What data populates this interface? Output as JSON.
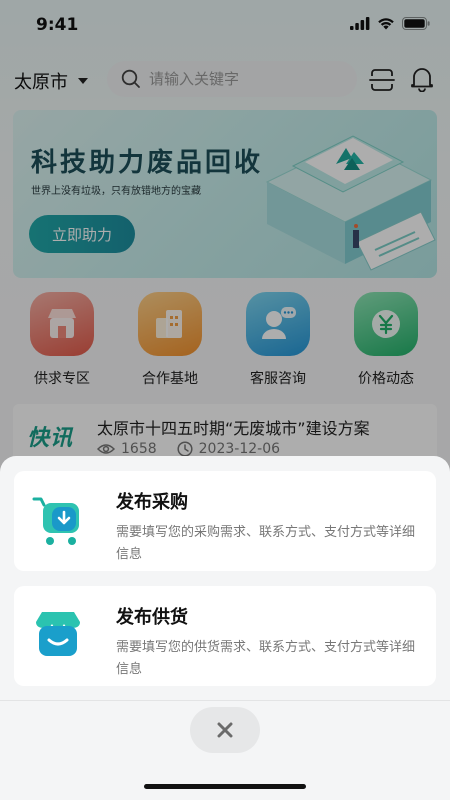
{
  "status_bar": {
    "time": "9:41"
  },
  "header": {
    "city": "太原市",
    "search_placeholder": "请输入关键字"
  },
  "banner": {
    "title": "科技助力废品回收",
    "subtitle": "世界上没有垃圾，只有放错地方的宝藏",
    "button_label": "立即助力"
  },
  "quick_links": [
    {
      "label": "供求专区",
      "icon": "shop-icon"
    },
    {
      "label": "合作基地",
      "icon": "buildings-icon"
    },
    {
      "label": "客服咨询",
      "icon": "customer-service-icon"
    },
    {
      "label": "价格动态",
      "icon": "yuan-coin-icon"
    }
  ],
  "news": {
    "badge": "快讯",
    "headline": "太原市十四五时期“无废城市”建设方案",
    "views": "1658",
    "date": "2023-12-06"
  },
  "sheet": {
    "options": [
      {
        "title": "发布采购",
        "description": "需要填写您的采购需求、联系方式、支付方式等详细信息",
        "icon": "shopping-cart-icon"
      },
      {
        "title": "发布供货",
        "description": "需要填写您的供货需求、联系方式、支付方式等详细信息",
        "icon": "store-icon"
      }
    ],
    "close_icon": "close-icon"
  },
  "colors": {
    "accent": "#1fb4a4",
    "accent_dark": "#1d8fa0",
    "overlay": "rgba(0,0,0,0.32)"
  }
}
